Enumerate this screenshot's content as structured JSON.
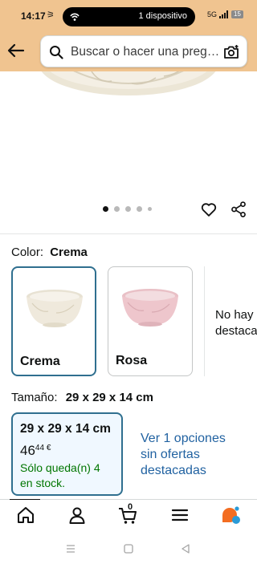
{
  "status_bar": {
    "time": "14:17",
    "pill_text": "1 dispositivo",
    "network": "5G",
    "battery": "15"
  },
  "search": {
    "placeholder": "Buscar o hacer una pregunta"
  },
  "product_images": {
    "dot_count": 5,
    "active_index": 0
  },
  "color": {
    "label": "Color:",
    "selected_value": "Crema",
    "options": [
      {
        "name": "Crema",
        "selected": true,
        "bowl_color": "#efe9dc"
      },
      {
        "name": "Rosa",
        "selected": false,
        "bowl_color": "#eec6cc"
      }
    ],
    "no_offers_text": [
      "No hay",
      "destaca"
    ]
  },
  "size": {
    "label": "Tamaño:",
    "selected_value": "29 x 29 x 14 cm",
    "card": {
      "size": "29 x 29 x 14 cm",
      "price_whole": "46",
      "price_fraction": "44 €",
      "stock": [
        "Sólo queda(n) 4",
        "en stock."
      ]
    },
    "see_options": [
      "Ver 1 opciones",
      "sin ofertas",
      "destacadas"
    ]
  },
  "tabbar": {
    "cart_count": "0",
    "tabs": [
      "home-icon",
      "account-icon",
      "cart-icon",
      "menu-icon",
      "rufus-assistant-icon"
    ]
  },
  "colors": {
    "header_bg": "#f0c490",
    "selected_border": "#2f6f8f",
    "link": "#2162a1",
    "stock_green": "#007600"
  }
}
